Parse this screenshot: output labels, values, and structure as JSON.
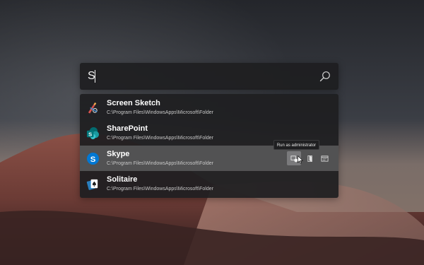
{
  "search": {
    "value": "S"
  },
  "results": [
    {
      "title": "Screen Sketch",
      "path": "C:\\Program Files\\WindowsApps\\Microsoft\\Folder",
      "icon": "screen-sketch-icon"
    },
    {
      "title": "SharePoint",
      "path": "C:\\Program Files\\WindowsApps\\Microsoft\\Folder",
      "icon": "sharepoint-icon"
    },
    {
      "title": "Skype",
      "path": "C:\\Program Files\\WindowsApps\\Microsoft\\Folder",
      "icon": "skype-icon",
      "selected": true
    },
    {
      "title": "Solitaire",
      "path": "C:\\Program Files\\WindowsApps\\Microsoft\\Folder",
      "icon": "solitaire-icon"
    }
  ],
  "context_actions": [
    {
      "icon": "run-as-admin-icon"
    },
    {
      "icon": "open-file-location-icon"
    },
    {
      "icon": "open-in-console-icon"
    }
  ],
  "tooltip": {
    "text": "Run as administrator"
  },
  "colors": {
    "panel": "#1e1e20",
    "selected_row": "#5a5a5c",
    "sharepoint": "#036c70",
    "skype": "#0078d4"
  }
}
